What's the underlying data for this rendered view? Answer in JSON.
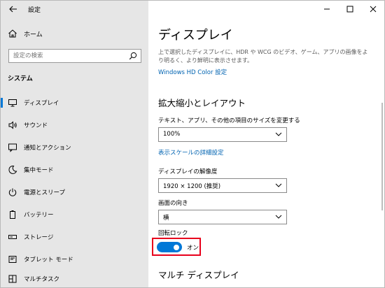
{
  "window": {
    "title": "設定",
    "controls": {
      "minimize": "—",
      "maximize": "☐",
      "close": "✕"
    }
  },
  "sidebar": {
    "home_label": "ホーム",
    "search_placeholder": "設定の検索",
    "section_header": "システム",
    "items": [
      {
        "label": "ディスプレイ",
        "icon": "display-icon",
        "selected": true
      },
      {
        "label": "サウンド",
        "icon": "speaker-icon"
      },
      {
        "label": "通知とアクション",
        "icon": "notification-icon"
      },
      {
        "label": "集中モード",
        "icon": "moon-icon"
      },
      {
        "label": "電源とスリープ",
        "icon": "power-icon"
      },
      {
        "label": "バッテリー",
        "icon": "battery-icon"
      },
      {
        "label": "ストレージ",
        "icon": "storage-icon"
      },
      {
        "label": "タブレット モード",
        "icon": "tablet-icon"
      },
      {
        "label": "マルチタスク",
        "icon": "multitask-icon"
      }
    ]
  },
  "main": {
    "title": "ディスプレイ",
    "description": "上で選択したディスプレイに、HDR や WCG のビデオ、ゲーム、アプリの画像をより明るく、より鮮明に表示させます。",
    "hdr_link": "Windows HD Color 設定",
    "scale_layout": {
      "heading": "拡大縮小とレイアウト",
      "text_size_label": "テキスト、アプリ、その他の項目のサイズを変更する",
      "text_size_value": "100%",
      "advanced_scale_link": "表示スケールの詳細設定",
      "resolution_label": "ディスプレイの解像度",
      "resolution_value": "1920 × 1200 (推奨)",
      "orientation_label": "画面の向き",
      "orientation_value": "横",
      "rotation_lock_label": "回転ロック",
      "rotation_lock_state": "オン"
    },
    "multi_display_heading": "マルチ ディスプレイ"
  },
  "colors": {
    "accent": "#0078d7",
    "highlight": "#e8001c",
    "sidebar_bg": "#e6e6e6",
    "link": "#0063b1"
  }
}
